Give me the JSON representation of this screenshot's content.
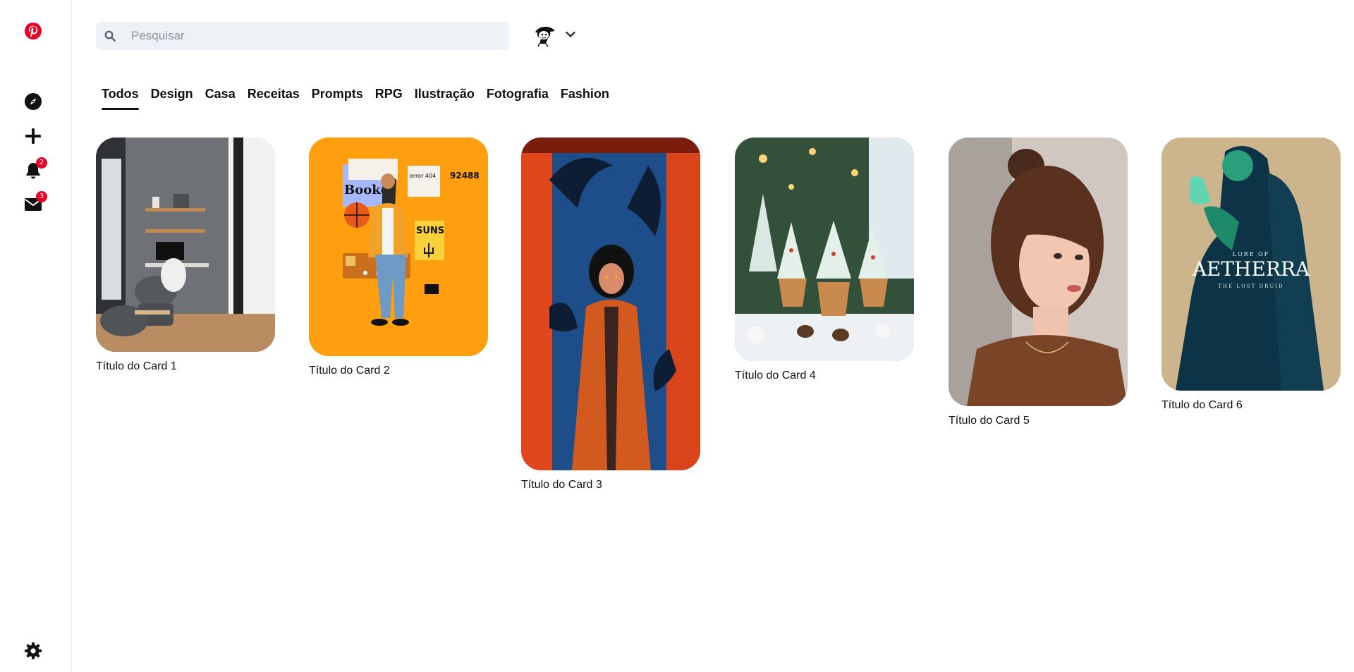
{
  "sidebar": {
    "logo": {
      "icon": "pinterest-logo",
      "color": "#e60023"
    },
    "items": [
      {
        "name": "explore",
        "icon": "compass-icon"
      },
      {
        "name": "create",
        "icon": "plus-icon"
      },
      {
        "name": "notifications",
        "icon": "bell-icon",
        "badge": "2"
      },
      {
        "name": "messages",
        "icon": "envelope-icon",
        "badge": "3"
      }
    ],
    "settings": {
      "icon": "gear-icon"
    }
  },
  "header": {
    "search": {
      "placeholder": "Pesquisar",
      "value": ""
    },
    "account": {
      "avatar": "avatar",
      "menu_icon": "chevron-down-icon"
    }
  },
  "tabs": [
    {
      "label": "Todos",
      "active": true
    },
    {
      "label": "Design"
    },
    {
      "label": "Casa"
    },
    {
      "label": "Receitas"
    },
    {
      "label": "Prompts"
    },
    {
      "label": "RPG"
    },
    {
      "label": "Ilustração"
    },
    {
      "label": "Fotografia"
    },
    {
      "label": "Fashion"
    }
  ],
  "cards": [
    {
      "title": "Título do Card 1",
      "image": "home office balcony"
    },
    {
      "title": "Título do Card 2",
      "image": "orange poster collage",
      "poster_text": "Booker",
      "poster_text2": "SUNS",
      "poster_number": "92488",
      "poster_error": "error 404"
    },
    {
      "title": "Título do Card 3",
      "image": "illustration girl in doorway"
    },
    {
      "title": "Título do Card 4",
      "image": "christmas cupcakes"
    },
    {
      "title": "Título do Card 5",
      "image": "woman portrait"
    },
    {
      "title": "Título do Card 6",
      "image": "fantasy book cover",
      "cover_top": "LORE OF",
      "cover_title": "AETHERRA",
      "cover_subtitle": "THE LOST DRUID"
    }
  ],
  "colors": {
    "brand": "#e60023",
    "badge": "#e60023",
    "search_bg": "#eef2f6"
  }
}
